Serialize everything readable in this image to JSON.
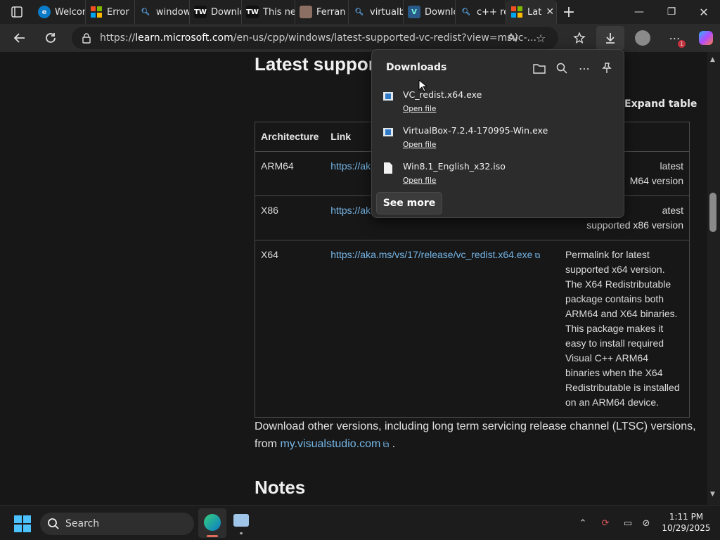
{
  "tabs": [
    {
      "label": "Welcome",
      "icon": "edge-icon"
    },
    {
      "label": "Error",
      "icon": "microsoft-logo-icon"
    },
    {
      "label": "window",
      "icon": "search-icon"
    },
    {
      "label": "Downlo",
      "icon": "tw-logo-icon"
    },
    {
      "label": "This ne",
      "icon": "tw-logo-icon"
    },
    {
      "label": "Ferran",
      "icon": "profile-photo-icon"
    },
    {
      "label": "virtualb",
      "icon": "search-icon"
    },
    {
      "label": "Downlo",
      "icon": "vs-logo-icon"
    },
    {
      "label": "c++ red",
      "icon": "search-icon"
    },
    {
      "label": "Lat",
      "icon": "microsoft-logo-icon",
      "active": true
    }
  ],
  "url": {
    "prefix": "https://",
    "host": "learn.microsoft.com",
    "path": "/en-us/cpp/windows/latest-supported-vc-redist?view=msvc-..."
  },
  "page": {
    "title": "Latest suppor",
    "expand_table": "Expand table",
    "table_headers": [
      "Architecture",
      "Link",
      ""
    ],
    "rows": [
      {
        "arch": "ARM64",
        "link": "https://ak",
        "desc": "latest\nM64 version"
      },
      {
        "arch": "X86",
        "link": "https://ak",
        "desc": "atest\nsupported x86 version"
      },
      {
        "arch": "X64",
        "link": "https://aka.ms/vs/17/release/vc_redist.x64.exe",
        "desc": "Permalink for latest supported x64 version. The X64 Redistributable package contains both ARM64 and X64 binaries. This package makes it easy to install required Visual C++ ARM64 binaries when the X64 Redistributable is installed on an ARM64 device."
      }
    ],
    "para_text": "Download other versions, including long term servicing release channel (LTSC) versions, from ",
    "para_link": "my.visualstudio.com",
    "para_end": " .",
    "notes": "Notes"
  },
  "downloads": {
    "header": "Downloads",
    "items": [
      {
        "name": "VC_redist.x64.exe",
        "action": "Open file"
      },
      {
        "name": "VirtualBox-7.2.4-170995-Win.exe",
        "action": "Open file"
      },
      {
        "name": "Win8.1_English_x32.iso",
        "action": "Open file"
      }
    ],
    "see_more": "See more"
  },
  "taskbar": {
    "search": "Search",
    "time": "1:11 PM",
    "date": "10/29/2025"
  },
  "colors": {
    "accent": "#75b6e7",
    "page_bg": "#171717"
  }
}
